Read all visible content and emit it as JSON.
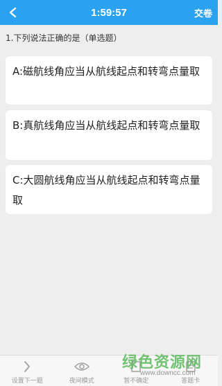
{
  "header": {
    "timer": "1:59:57",
    "submit_label": "交卷",
    "background_color": "#2aa2f0"
  },
  "question": {
    "text": "1.下列说法正确的是（单选题）"
  },
  "options": [
    {
      "text": "A:磁航线角应当从航线起点和转弯点量取"
    },
    {
      "text": "B:真航线角应当从航线起点和转弯点量取"
    },
    {
      "text": "C:大圆航线角应当从航线起点和转弯点量取"
    }
  ],
  "bottom_nav": {
    "items": [
      {
        "label": "设置下一题",
        "icon": "chevron-right-icon"
      },
      {
        "label": "夜间模式",
        "icon": "eye-icon"
      },
      {
        "label": "暂不确定",
        "icon": "flag-icon"
      },
      {
        "label": "答题卡",
        "icon": "card-icon"
      }
    ]
  },
  "watermark": {
    "text": "绿色资源网",
    "url": "www.downcc.com"
  }
}
